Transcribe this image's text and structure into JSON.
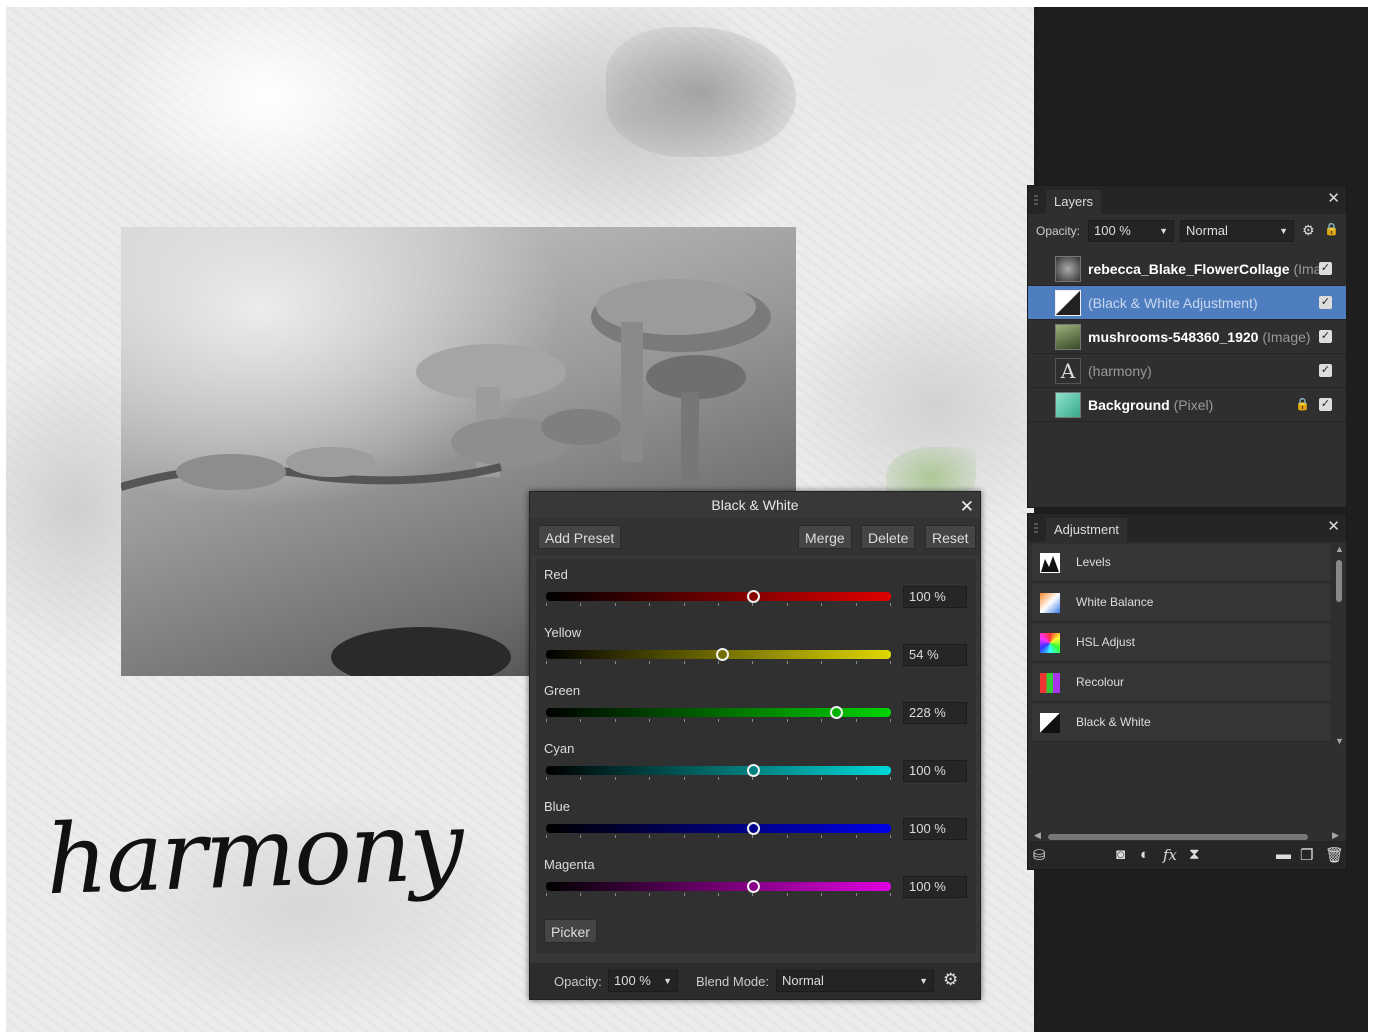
{
  "canvas": {
    "artwork_text": "harmony"
  },
  "layers_panel": {
    "tab": "Layers",
    "opacity_label": "Opacity:",
    "opacity_value": "100 %",
    "blend_value": "Normal",
    "layers": [
      {
        "name": "rebecca_Blake_FlowerCollage",
        "type": "(Ima",
        "selected": false
      },
      {
        "name": "",
        "type": "(Black & White Adjustment)",
        "selected": true
      },
      {
        "name": "mushrooms-548360_1920",
        "type": "(Image)",
        "selected": false
      },
      {
        "name": "",
        "type": "(harmony)",
        "selected": false
      },
      {
        "name": "Background",
        "type": "(Pixel)",
        "selected": false
      }
    ],
    "text_thumb_letter": "A"
  },
  "adjustment_panel": {
    "tab": "Adjustment",
    "items": [
      {
        "label": "Levels",
        "icon": "levels-icon"
      },
      {
        "label": "White Balance",
        "icon": "white-balance-icon"
      },
      {
        "label": "HSL Adjust",
        "icon": "hsl-icon"
      },
      {
        "label": "Recolour",
        "icon": "recolour-icon"
      },
      {
        "label": "Black & White",
        "icon": "black-white-icon"
      }
    ]
  },
  "bw_dialog": {
    "title": "Black & White",
    "add_preset": "Add Preset",
    "merge": "Merge",
    "delete": "Delete",
    "reset": "Reset",
    "picker": "Picker",
    "sliders": [
      {
        "label": "Red",
        "value": "100 %",
        "position": 0.6,
        "color": "#e00000"
      },
      {
        "label": "Yellow",
        "value": "54 %",
        "position": 0.51,
        "color": "#e0d800"
      },
      {
        "label": "Green",
        "value": "228 %",
        "position": 0.84,
        "color": "#00d400"
      },
      {
        "label": "Cyan",
        "value": "100 %",
        "position": 0.6,
        "color": "#00d8d8"
      },
      {
        "label": "Blue",
        "value": "100 %",
        "position": 0.6,
        "color": "#0000e8"
      },
      {
        "label": "Magenta",
        "value": "100 %",
        "position": 0.6,
        "color": "#e000e0"
      }
    ],
    "footer": {
      "opacity_label": "Opacity:",
      "opacity_value": "100 %",
      "blend_label": "Blend Mode:",
      "blend_value": "Normal"
    }
  }
}
